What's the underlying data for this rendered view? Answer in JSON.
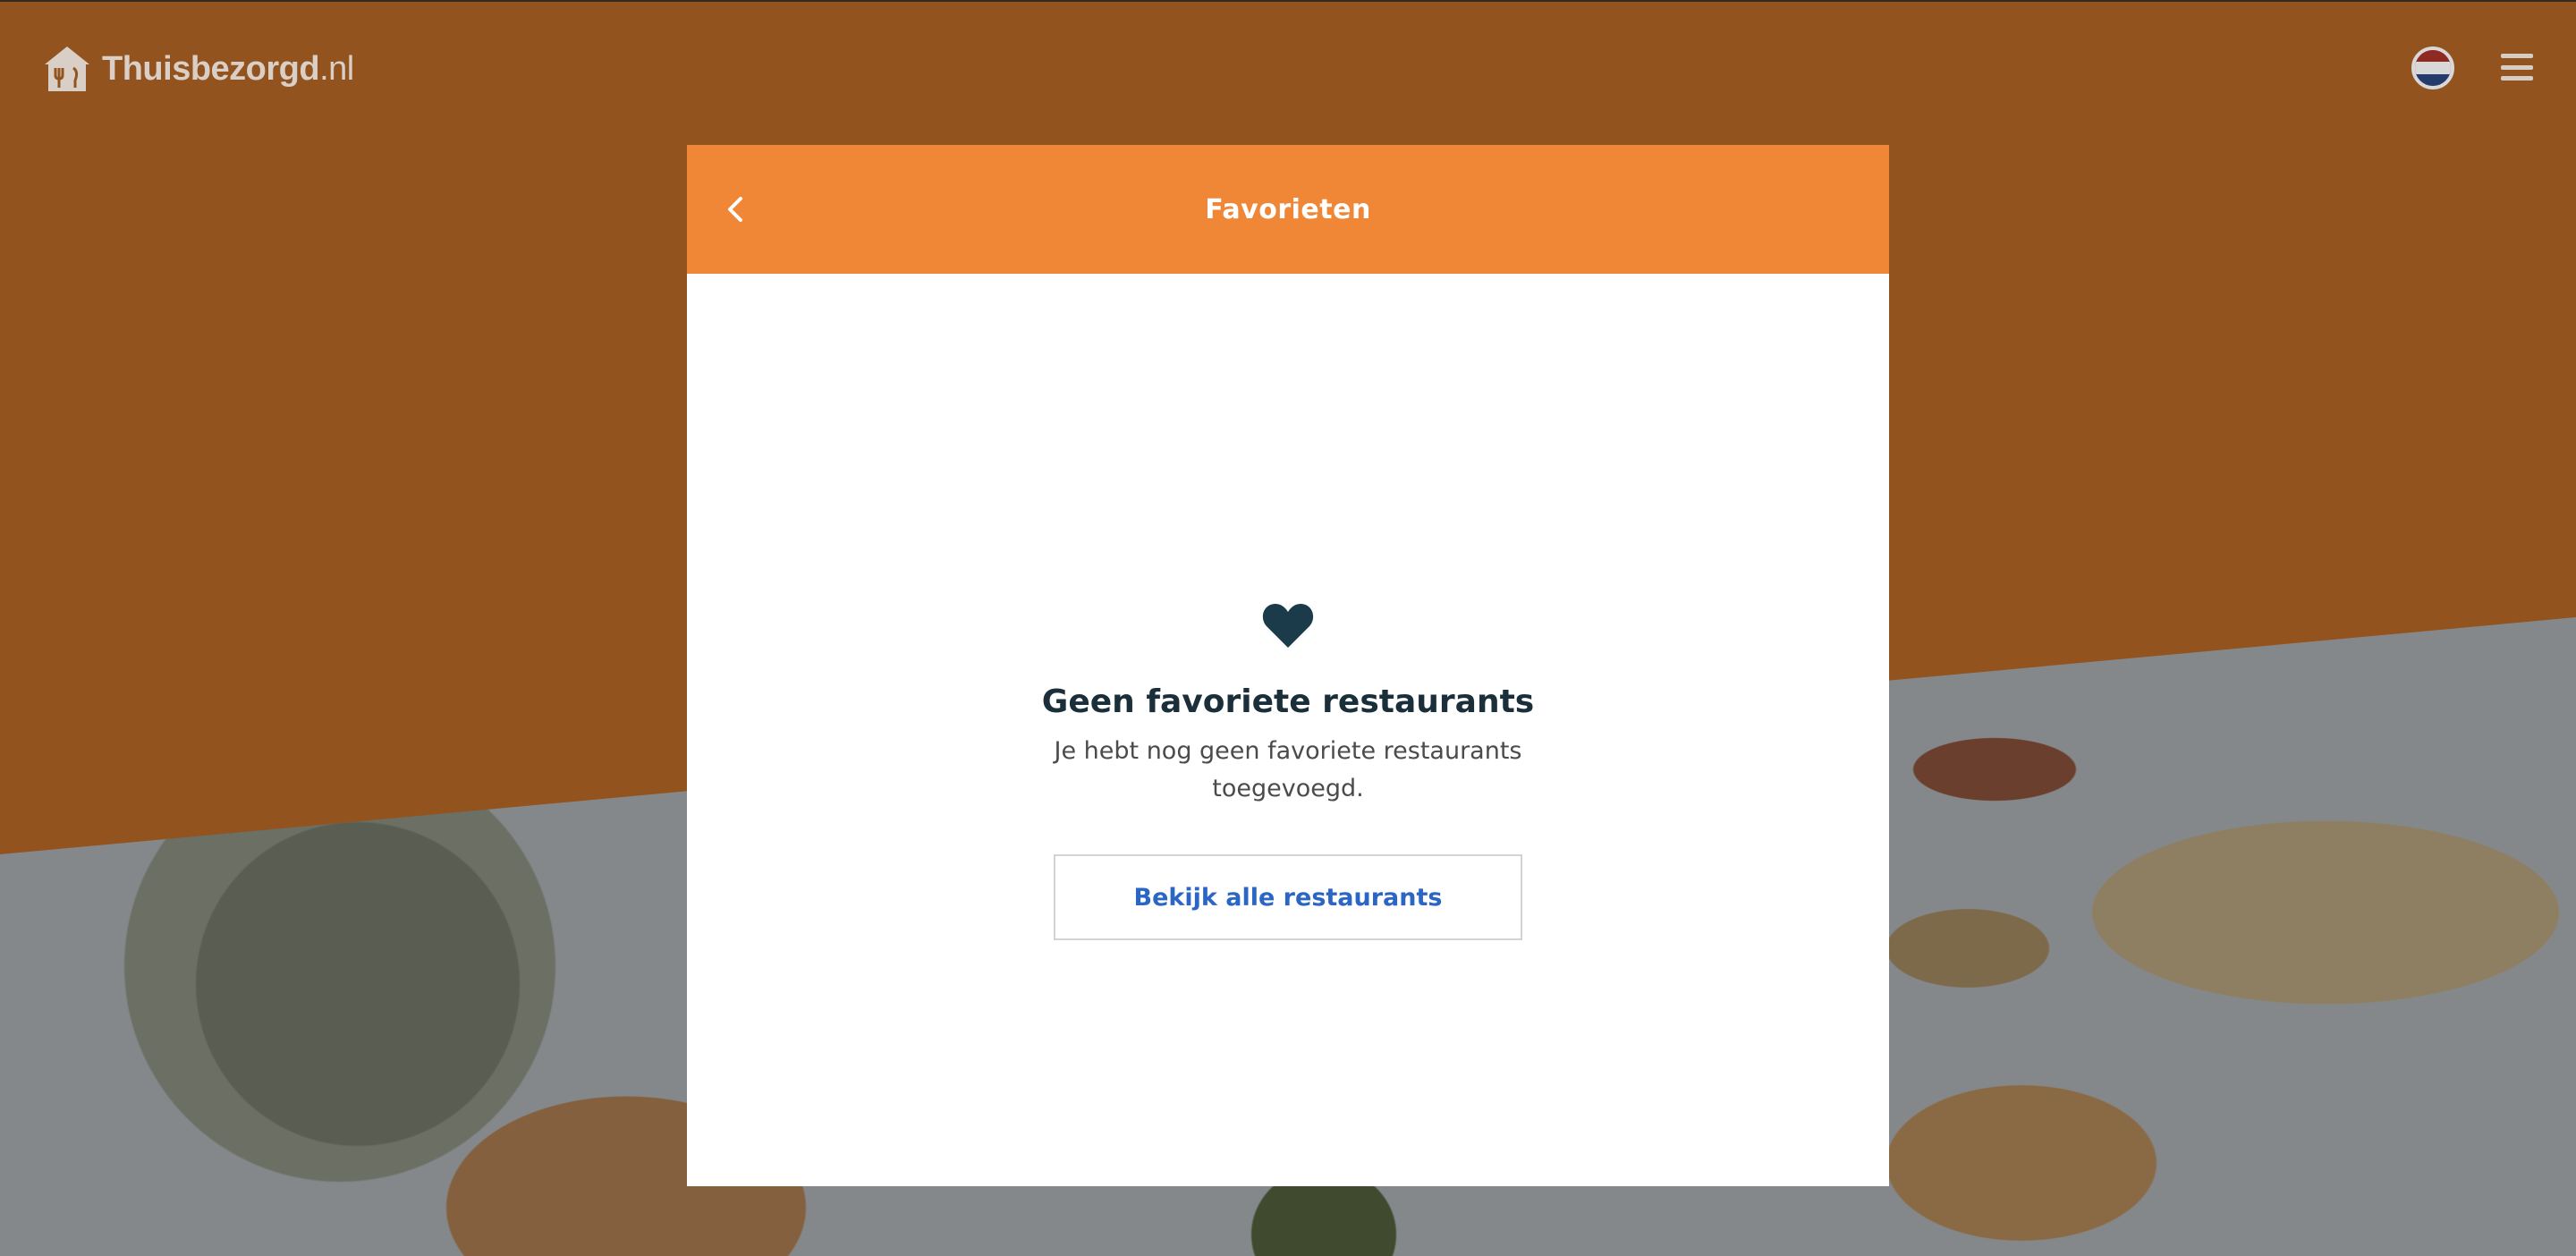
{
  "header": {
    "logo_text": "Thuisbezorgd",
    "logo_tld": ".nl",
    "logo_icon": "house-fork-icon",
    "language_icon": "netherlands-flag-icon",
    "menu_icon": "hamburger-menu-icon"
  },
  "modal": {
    "title": "Favorieten",
    "back_icon": "chevron-left-icon",
    "empty_icon": "heart-icon",
    "empty_title": "Geen favoriete restaurants",
    "empty_text": "Je hebt nog geen favoriete restaurants toegevoegd.",
    "cta_label": "Bekijk alle restaurants"
  },
  "colors": {
    "brand_orange": "#f08736",
    "dimmed_orange": "#93531f",
    "link_blue": "#2c66c4",
    "heading_dark": "#1b2f3a"
  }
}
